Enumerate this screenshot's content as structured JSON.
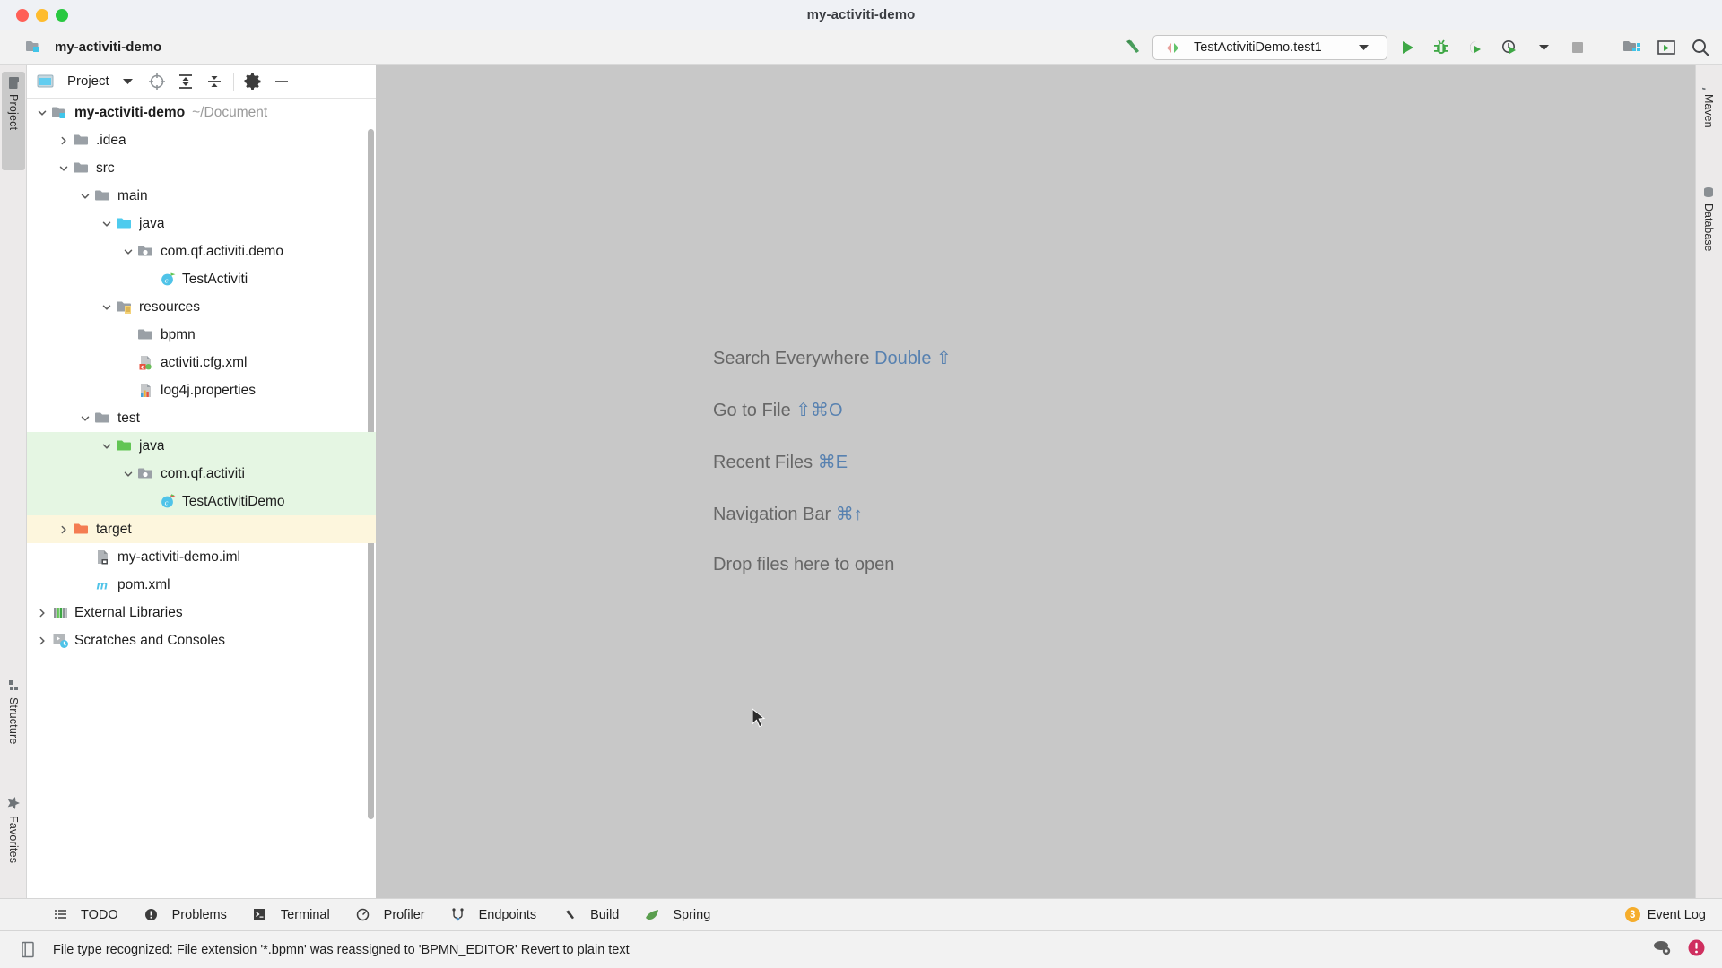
{
  "window": {
    "title": "my-activiti-demo",
    "traffic_lights": [
      "close-button",
      "minimize-button",
      "maximize-button"
    ]
  },
  "navbar": {
    "project_name": "my-activiti-demo",
    "project_icon": "module-folder-icon"
  },
  "toolbar": {
    "build_icon": "hammer-icon",
    "run_config": {
      "icon": "run-config-icon",
      "label": "TestActivitiDemo.test1",
      "dropdown": "chevron-down-icon"
    },
    "buttons": [
      {
        "name": "run-button",
        "icon": "play-icon"
      },
      {
        "name": "debug-button",
        "icon": "bug-icon"
      },
      {
        "name": "run-with-coverage-button",
        "icon": "coverage-icon"
      },
      {
        "name": "profile-button",
        "icon": "profiler-icon"
      },
      {
        "name": "profile-dropdown",
        "icon": "chevron-down-icon"
      },
      {
        "name": "stop-button",
        "icon": "stop-square-icon"
      },
      {
        "name": "project-structure-button",
        "icon": "project-structure-icon"
      },
      {
        "name": "presentation-button",
        "icon": "presentation-icon"
      },
      {
        "name": "search-everywhere-button",
        "icon": "search-icon"
      }
    ]
  },
  "left_strip": {
    "tabs": [
      {
        "label": "Project",
        "icon": "folder-icon",
        "active": true
      },
      {
        "label": "Structure",
        "icon": "structure-icon",
        "active": false
      },
      {
        "label": "Favorites",
        "icon": "star-icon",
        "active": false
      }
    ]
  },
  "right_strip": {
    "tabs": [
      {
        "label": "Maven",
        "icon": "maven-m-icon"
      },
      {
        "label": "Database",
        "icon": "database-icon"
      }
    ]
  },
  "project_panel": {
    "title": "Project",
    "title_icon": "project-view-icon",
    "title_dropdown": "chevron-down-icon",
    "header_buttons": [
      {
        "name": "scroll-from-source-button",
        "icon": "target-icon"
      },
      {
        "name": "expand-all-button",
        "icon": "expand-all-icon"
      },
      {
        "name": "collapse-all-button",
        "icon": "collapse-all-icon"
      },
      {
        "name": "settings-button",
        "icon": "gear-icon"
      },
      {
        "name": "hide-button",
        "icon": "minus-icon"
      }
    ],
    "tree": [
      {
        "label": "my-activiti-demo",
        "sub": "~/Document",
        "depth": 0,
        "arrow": "expanded",
        "icon": "module-folder-icon",
        "bold": true,
        "state": "normal"
      },
      {
        "label": ".idea",
        "sub": "",
        "depth": 1,
        "arrow": "collapsed",
        "icon": "folder-icon",
        "bold": false,
        "state": "normal"
      },
      {
        "label": "src",
        "sub": "",
        "depth": 1,
        "arrow": "expanded",
        "icon": "folder-icon",
        "bold": false,
        "state": "normal"
      },
      {
        "label": "main",
        "sub": "",
        "depth": 2,
        "arrow": "expanded",
        "icon": "folder-icon",
        "bold": false,
        "state": "normal"
      },
      {
        "label": "java",
        "sub": "",
        "depth": 3,
        "arrow": "expanded",
        "icon": "source-folder-icon",
        "bold": false,
        "state": "normal"
      },
      {
        "label": "com.qf.activiti.demo",
        "sub": "",
        "depth": 4,
        "arrow": "expanded",
        "icon": "package-icon",
        "bold": false,
        "state": "normal"
      },
      {
        "label": "TestActiviti",
        "sub": "",
        "depth": 5,
        "arrow": "none",
        "icon": "java-class-icon",
        "bold": false,
        "state": "normal"
      },
      {
        "label": "resources",
        "sub": "",
        "depth": 3,
        "arrow": "expanded",
        "icon": "resources-folder-icon",
        "bold": false,
        "state": "normal"
      },
      {
        "label": "bpmn",
        "sub": "",
        "depth": 4,
        "arrow": "none",
        "icon": "folder-icon",
        "bold": false,
        "state": "normal"
      },
      {
        "label": "activiti.cfg.xml",
        "sub": "",
        "depth": 4,
        "arrow": "none",
        "icon": "xml-file-icon",
        "bold": false,
        "state": "normal"
      },
      {
        "label": "log4j.properties",
        "sub": "",
        "depth": 4,
        "arrow": "none",
        "icon": "properties-file-icon",
        "bold": false,
        "state": "normal"
      },
      {
        "label": "test",
        "sub": "",
        "depth": 2,
        "arrow": "expanded",
        "icon": "folder-icon",
        "bold": false,
        "state": "normal"
      },
      {
        "label": "java",
        "sub": "",
        "depth": 3,
        "arrow": "expanded",
        "icon": "test-source-folder-icon",
        "bold": false,
        "state": "test-src"
      },
      {
        "label": "com.qf.activiti",
        "sub": "",
        "depth": 4,
        "arrow": "expanded",
        "icon": "package-icon",
        "bold": false,
        "state": "test-src"
      },
      {
        "label": "TestActivitiDemo",
        "sub": "",
        "depth": 5,
        "arrow": "none",
        "icon": "java-test-class-icon",
        "bold": false,
        "state": "test-src"
      },
      {
        "label": "target",
        "sub": "",
        "depth": 1,
        "arrow": "collapsed",
        "icon": "excluded-folder-icon",
        "bold": false,
        "state": "excluded"
      },
      {
        "label": "my-activiti-demo.iml",
        "sub": "",
        "depth": 2,
        "arrow": "none",
        "icon": "iml-file-icon",
        "bold": false,
        "state": "normal"
      },
      {
        "label": "pom.xml",
        "sub": "",
        "depth": 2,
        "arrow": "none",
        "icon": "maven-m-icon",
        "bold": false,
        "state": "normal"
      },
      {
        "label": "External Libraries",
        "sub": "",
        "depth": 0,
        "arrow": "collapsed",
        "icon": "libraries-icon",
        "bold": false,
        "state": "normal"
      },
      {
        "label": "Scratches and Consoles",
        "sub": "",
        "depth": 0,
        "arrow": "collapsed",
        "icon": "scratches-icon",
        "bold": false,
        "state": "normal"
      }
    ]
  },
  "editor": {
    "hints": [
      {
        "text": "Search Everywhere",
        "keys": "Double ⇧"
      },
      {
        "text": "Go to File",
        "keys": "⇧⌘O"
      },
      {
        "text": "Recent Files",
        "keys": "⌘E"
      },
      {
        "text": "Navigation Bar",
        "keys": "⌘↑"
      },
      {
        "text": "Drop files here to open",
        "keys": ""
      }
    ]
  },
  "bottom_bar": {
    "items": [
      {
        "label": "TODO",
        "icon": "todo-list-icon"
      },
      {
        "label": "Problems",
        "icon": "problems-icon"
      },
      {
        "label": "Terminal",
        "icon": "terminal-icon"
      },
      {
        "label": "Profiler",
        "icon": "profiler-icon"
      },
      {
        "label": "Endpoints",
        "icon": "endpoints-icon"
      },
      {
        "label": "Build",
        "icon": "hammer-icon"
      },
      {
        "label": "Spring",
        "icon": "spring-leaf-icon"
      }
    ],
    "event_log": {
      "label": "Event Log",
      "count": "3"
    }
  },
  "status_bar": {
    "icon": "document-icon",
    "message": "File type recognized: File extension '*.bpmn' was reassigned to 'BPMN_EDITOR' Revert to plain text",
    "right_icons": [
      {
        "name": "background-tasks-icon"
      },
      {
        "name": "error-notification-icon"
      }
    ]
  },
  "colors": {
    "accent_blue": "#5781b0",
    "run_green": "#3ea745",
    "test_source_bg": "#e5f6e3",
    "excluded_bg": "#fdf6dd",
    "editor_bg": "#c8c8c8",
    "badge_orange": "#f5ad2c",
    "error_red": "#cf2f5f"
  }
}
